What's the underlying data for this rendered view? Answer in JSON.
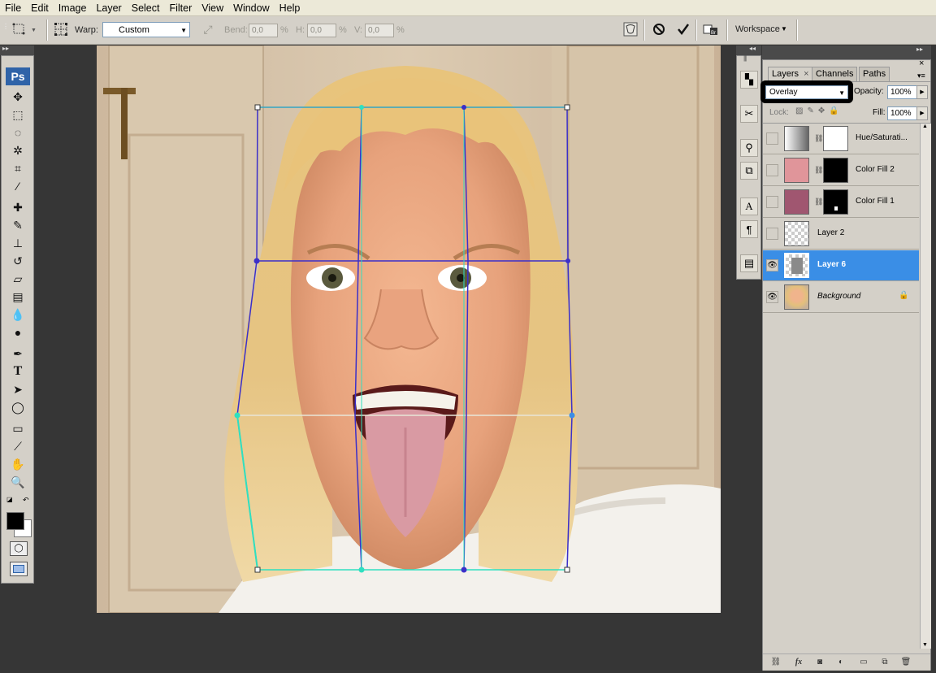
{
  "menu": [
    "File",
    "Edit",
    "Image",
    "Layer",
    "Select",
    "Filter",
    "View",
    "Window",
    "Help"
  ],
  "options_bar": {
    "warp_label": "Warp:",
    "warp_value": "Custom",
    "bend_label": "Bend:",
    "bend_value": "0,0",
    "h_label": "H:",
    "h_value": "0,0",
    "v_label": "V:",
    "v_value": "0,0",
    "percent": "%",
    "workspace_label": "Workspace"
  },
  "toolbox": {
    "logo": "Ps",
    "tools": [
      "move-tool",
      "marquee-tool",
      "lasso-tool",
      "magic-wand-tool",
      "crop-tool",
      "slice-tool",
      "healing-brush-tool",
      "brush-tool",
      "clone-stamp-tool",
      "history-brush-tool",
      "eraser-tool",
      "gradient-tool",
      "blur-tool",
      "dodge-tool",
      "pen-tool",
      "type-tool",
      "path-selection-tool",
      "shape-tool",
      "notes-tool",
      "eyedropper-tool",
      "hand-tool",
      "zoom-tool"
    ],
    "type_glyph": "T",
    "foreground_color": "#000000",
    "background_color": "#ffffff"
  },
  "layers_panel": {
    "tabs": [
      "Layers",
      "Channels",
      "Paths"
    ],
    "tab_close": "×",
    "blend_mode": "Overlay",
    "opacity_label": "Opacity:",
    "opacity_value": "100%",
    "lock_label": "Lock:",
    "fill_label": "Fill:",
    "fill_value": "100%",
    "layers": [
      {
        "name": "Hue/Saturati...",
        "visible": false,
        "selected": false,
        "thumb_color": "#9a9a9a",
        "mask": "white"
      },
      {
        "name": "Color Fill 2",
        "visible": false,
        "selected": false,
        "thumb_color": "#e0959a",
        "mask": "black"
      },
      {
        "name": "Color Fill 1",
        "visible": false,
        "selected": false,
        "thumb_color": "#a05670",
        "mask": "black"
      },
      {
        "name": "Layer 2",
        "visible": false,
        "selected": false,
        "thumb_color": "checker",
        "mask": ""
      },
      {
        "name": "Layer 6",
        "visible": true,
        "selected": true,
        "thumb_color": "#8a8a8a",
        "mask": ""
      },
      {
        "name": "Background",
        "visible": true,
        "selected": false,
        "thumb_color": "photo",
        "mask": "",
        "locked": true
      }
    ],
    "footer_icons": [
      "link-icon",
      "fx-icon",
      "mask-icon",
      "adjustment-icon",
      "folder-icon",
      "new-layer-icon",
      "trash-icon"
    ],
    "fx_label": "fx"
  },
  "colors": {
    "accent": "#3a8ee6",
    "warp_grid_blue": "#3b2fc9",
    "warp_grid_cyan": "#2fe0c0"
  }
}
